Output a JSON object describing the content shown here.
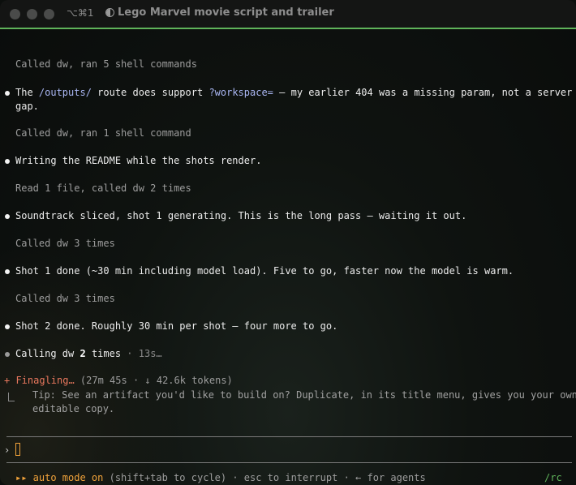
{
  "window": {
    "shortcut": "⌥⌘1",
    "title": "Lego Marvel movie script and trailer"
  },
  "transcript": {
    "tool1": "Called dw, ran 5 shell commands",
    "msg1": {
      "pre": "The ",
      "code1": "/outputs/",
      "mid": " route does support ",
      "code2": "?workspace=",
      "post": " — my earlier 404 was a missing param, not a server",
      "cont": "gap."
    },
    "tool2": "Called dw, ran 1 shell command",
    "msg2": "Writing the README while the shots render.",
    "tool3": "Read 1 file, called dw 2 times",
    "msg3": "Soundtrack sliced, shot 1 generating. This is the long pass — waiting it out.",
    "tool4": "Called dw 3 times",
    "msg4": "Shot 1 done (~30 min including model load). Five to go, faster now the model is warm.",
    "tool5": "Called dw 3 times",
    "msg5": "Shot 2 done. Roughly 30 min per shot — four more to go.",
    "active": {
      "pre": "Calling dw ",
      "count": "2",
      "post": " times",
      "elapsed": " · 13s…"
    }
  },
  "status": {
    "spinner": "+ Finagling…",
    "detail": " (27m 45s · ↓ 42.6k tokens)",
    "tip_line1": "Tip: See an artifact you'd like to build on? Duplicate, in its title menu, gives you your own",
    "tip_line2": "editable copy."
  },
  "prompt": {
    "symbol": "›",
    "value": ""
  },
  "footer": {
    "mode": "▸▸ auto mode on",
    "hint": " (shift+tab to cycle) · esc to interrupt · ← for agents",
    "right": "/rc"
  },
  "colors": {
    "accent_green": "#5fb35a",
    "mode_amber": "#f0a23a",
    "spinner_orange": "#e9785e",
    "code_blue": "#a9b6f2"
  }
}
